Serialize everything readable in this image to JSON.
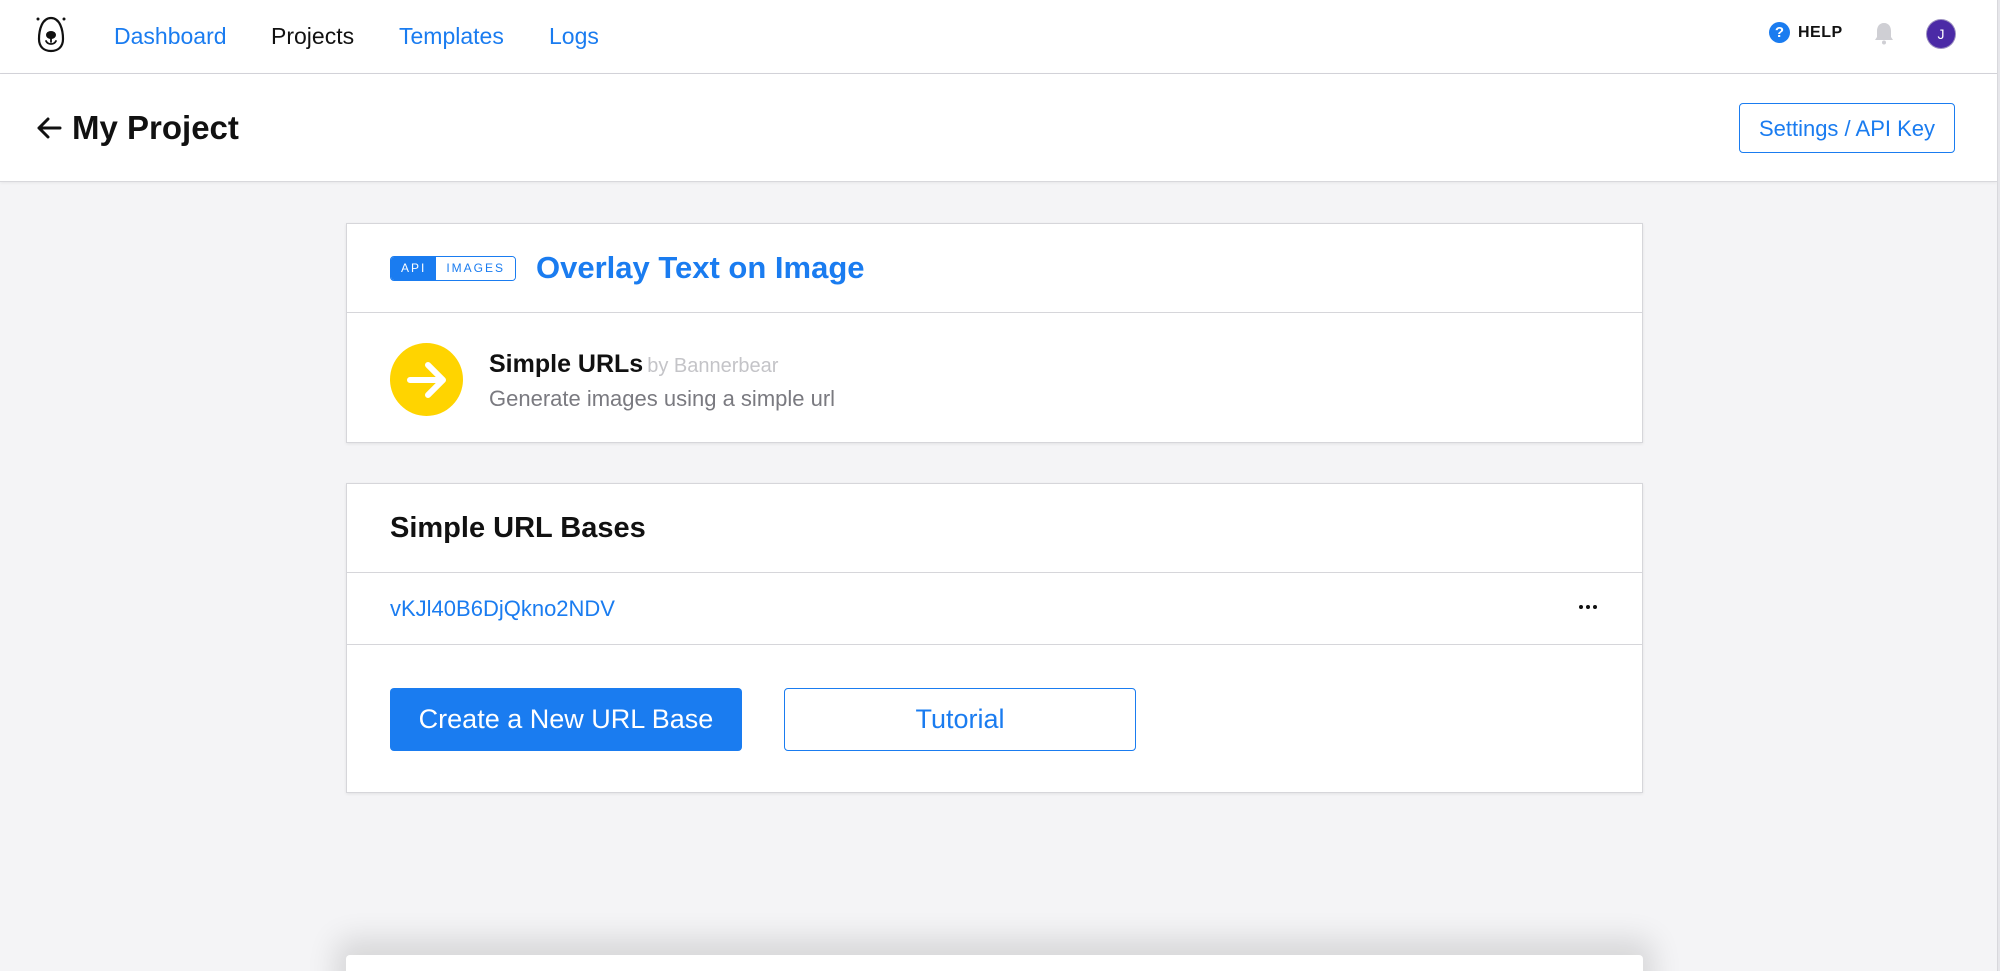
{
  "nav": {
    "logo": "bannerbear-bear-logo",
    "links": [
      {
        "label": "Dashboard",
        "active": false
      },
      {
        "label": "Projects",
        "active": true
      },
      {
        "label": "Templates",
        "active": false
      },
      {
        "label": "Logs",
        "active": false
      }
    ],
    "help_label": "HELP",
    "avatar_initial": "J"
  },
  "header": {
    "back_icon": "arrow-left-icon",
    "title": "My Project",
    "settings_button": "Settings / API Key"
  },
  "integration_card": {
    "badge": {
      "left": "API",
      "right": "IMAGES"
    },
    "title": "Overlay Text on Image",
    "integration": {
      "icon": "arrow-right-circle-icon",
      "name": "Simple URLs",
      "by": "by Bannerbear",
      "description": "Generate images using a simple url"
    }
  },
  "url_bases_card": {
    "title": "Simple URL Bases",
    "items": [
      {
        "id": "vKJl40B6DjQkno2NDV"
      }
    ],
    "create_button": "Create a New URL Base",
    "tutorial_button": "Tutorial"
  },
  "colors": {
    "accent": "#1a7cf0",
    "integration_icon_bg": "#ffd400",
    "avatar_bg": "#4b2aa6",
    "page_bg": "#f4f4f6"
  }
}
